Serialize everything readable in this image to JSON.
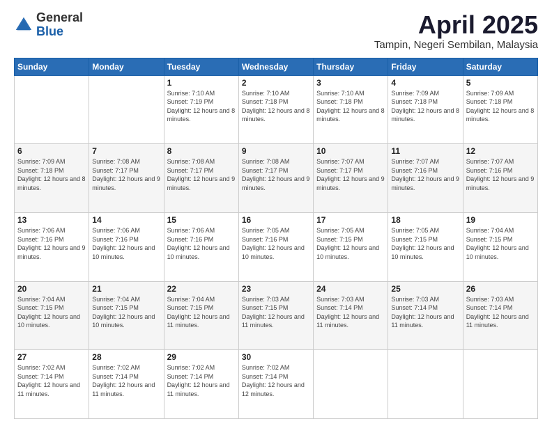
{
  "header": {
    "logo": {
      "general": "General",
      "blue": "Blue"
    },
    "title": "April 2025",
    "location": "Tampin, Negeri Sembilan, Malaysia"
  },
  "weekdays": [
    "Sunday",
    "Monday",
    "Tuesday",
    "Wednesday",
    "Thursday",
    "Friday",
    "Saturday"
  ],
  "weeks": [
    [
      {
        "day": "",
        "sunrise": "",
        "sunset": "",
        "daylight": ""
      },
      {
        "day": "",
        "sunrise": "",
        "sunset": "",
        "daylight": ""
      },
      {
        "day": "1",
        "sunrise": "Sunrise: 7:10 AM",
        "sunset": "Sunset: 7:19 PM",
        "daylight": "Daylight: 12 hours and 8 minutes."
      },
      {
        "day": "2",
        "sunrise": "Sunrise: 7:10 AM",
        "sunset": "Sunset: 7:18 PM",
        "daylight": "Daylight: 12 hours and 8 minutes."
      },
      {
        "day": "3",
        "sunrise": "Sunrise: 7:10 AM",
        "sunset": "Sunset: 7:18 PM",
        "daylight": "Daylight: 12 hours and 8 minutes."
      },
      {
        "day": "4",
        "sunrise": "Sunrise: 7:09 AM",
        "sunset": "Sunset: 7:18 PM",
        "daylight": "Daylight: 12 hours and 8 minutes."
      },
      {
        "day": "5",
        "sunrise": "Sunrise: 7:09 AM",
        "sunset": "Sunset: 7:18 PM",
        "daylight": "Daylight: 12 hours and 8 minutes."
      }
    ],
    [
      {
        "day": "6",
        "sunrise": "Sunrise: 7:09 AM",
        "sunset": "Sunset: 7:18 PM",
        "daylight": "Daylight: 12 hours and 8 minutes."
      },
      {
        "day": "7",
        "sunrise": "Sunrise: 7:08 AM",
        "sunset": "Sunset: 7:17 PM",
        "daylight": "Daylight: 12 hours and 9 minutes."
      },
      {
        "day": "8",
        "sunrise": "Sunrise: 7:08 AM",
        "sunset": "Sunset: 7:17 PM",
        "daylight": "Daylight: 12 hours and 9 minutes."
      },
      {
        "day": "9",
        "sunrise": "Sunrise: 7:08 AM",
        "sunset": "Sunset: 7:17 PM",
        "daylight": "Daylight: 12 hours and 9 minutes."
      },
      {
        "day": "10",
        "sunrise": "Sunrise: 7:07 AM",
        "sunset": "Sunset: 7:17 PM",
        "daylight": "Daylight: 12 hours and 9 minutes."
      },
      {
        "day": "11",
        "sunrise": "Sunrise: 7:07 AM",
        "sunset": "Sunset: 7:16 PM",
        "daylight": "Daylight: 12 hours and 9 minutes."
      },
      {
        "day": "12",
        "sunrise": "Sunrise: 7:07 AM",
        "sunset": "Sunset: 7:16 PM",
        "daylight": "Daylight: 12 hours and 9 minutes."
      }
    ],
    [
      {
        "day": "13",
        "sunrise": "Sunrise: 7:06 AM",
        "sunset": "Sunset: 7:16 PM",
        "daylight": "Daylight: 12 hours and 9 minutes."
      },
      {
        "day": "14",
        "sunrise": "Sunrise: 7:06 AM",
        "sunset": "Sunset: 7:16 PM",
        "daylight": "Daylight: 12 hours and 10 minutes."
      },
      {
        "day": "15",
        "sunrise": "Sunrise: 7:06 AM",
        "sunset": "Sunset: 7:16 PM",
        "daylight": "Daylight: 12 hours and 10 minutes."
      },
      {
        "day": "16",
        "sunrise": "Sunrise: 7:05 AM",
        "sunset": "Sunset: 7:16 PM",
        "daylight": "Daylight: 12 hours and 10 minutes."
      },
      {
        "day": "17",
        "sunrise": "Sunrise: 7:05 AM",
        "sunset": "Sunset: 7:15 PM",
        "daylight": "Daylight: 12 hours and 10 minutes."
      },
      {
        "day": "18",
        "sunrise": "Sunrise: 7:05 AM",
        "sunset": "Sunset: 7:15 PM",
        "daylight": "Daylight: 12 hours and 10 minutes."
      },
      {
        "day": "19",
        "sunrise": "Sunrise: 7:04 AM",
        "sunset": "Sunset: 7:15 PM",
        "daylight": "Daylight: 12 hours and 10 minutes."
      }
    ],
    [
      {
        "day": "20",
        "sunrise": "Sunrise: 7:04 AM",
        "sunset": "Sunset: 7:15 PM",
        "daylight": "Daylight: 12 hours and 10 minutes."
      },
      {
        "day": "21",
        "sunrise": "Sunrise: 7:04 AM",
        "sunset": "Sunset: 7:15 PM",
        "daylight": "Daylight: 12 hours and 10 minutes."
      },
      {
        "day": "22",
        "sunrise": "Sunrise: 7:04 AM",
        "sunset": "Sunset: 7:15 PM",
        "daylight": "Daylight: 12 hours and 11 minutes."
      },
      {
        "day": "23",
        "sunrise": "Sunrise: 7:03 AM",
        "sunset": "Sunset: 7:15 PM",
        "daylight": "Daylight: 12 hours and 11 minutes."
      },
      {
        "day": "24",
        "sunrise": "Sunrise: 7:03 AM",
        "sunset": "Sunset: 7:14 PM",
        "daylight": "Daylight: 12 hours and 11 minutes."
      },
      {
        "day": "25",
        "sunrise": "Sunrise: 7:03 AM",
        "sunset": "Sunset: 7:14 PM",
        "daylight": "Daylight: 12 hours and 11 minutes."
      },
      {
        "day": "26",
        "sunrise": "Sunrise: 7:03 AM",
        "sunset": "Sunset: 7:14 PM",
        "daylight": "Daylight: 12 hours and 11 minutes."
      }
    ],
    [
      {
        "day": "27",
        "sunrise": "Sunrise: 7:02 AM",
        "sunset": "Sunset: 7:14 PM",
        "daylight": "Daylight: 12 hours and 11 minutes."
      },
      {
        "day": "28",
        "sunrise": "Sunrise: 7:02 AM",
        "sunset": "Sunset: 7:14 PM",
        "daylight": "Daylight: 12 hours and 11 minutes."
      },
      {
        "day": "29",
        "sunrise": "Sunrise: 7:02 AM",
        "sunset": "Sunset: 7:14 PM",
        "daylight": "Daylight: 12 hours and 11 minutes."
      },
      {
        "day": "30",
        "sunrise": "Sunrise: 7:02 AM",
        "sunset": "Sunset: 7:14 PM",
        "daylight": "Daylight: 12 hours and 12 minutes."
      },
      {
        "day": "",
        "sunrise": "",
        "sunset": "",
        "daylight": ""
      },
      {
        "day": "",
        "sunrise": "",
        "sunset": "",
        "daylight": ""
      },
      {
        "day": "",
        "sunrise": "",
        "sunset": "",
        "daylight": ""
      }
    ]
  ]
}
